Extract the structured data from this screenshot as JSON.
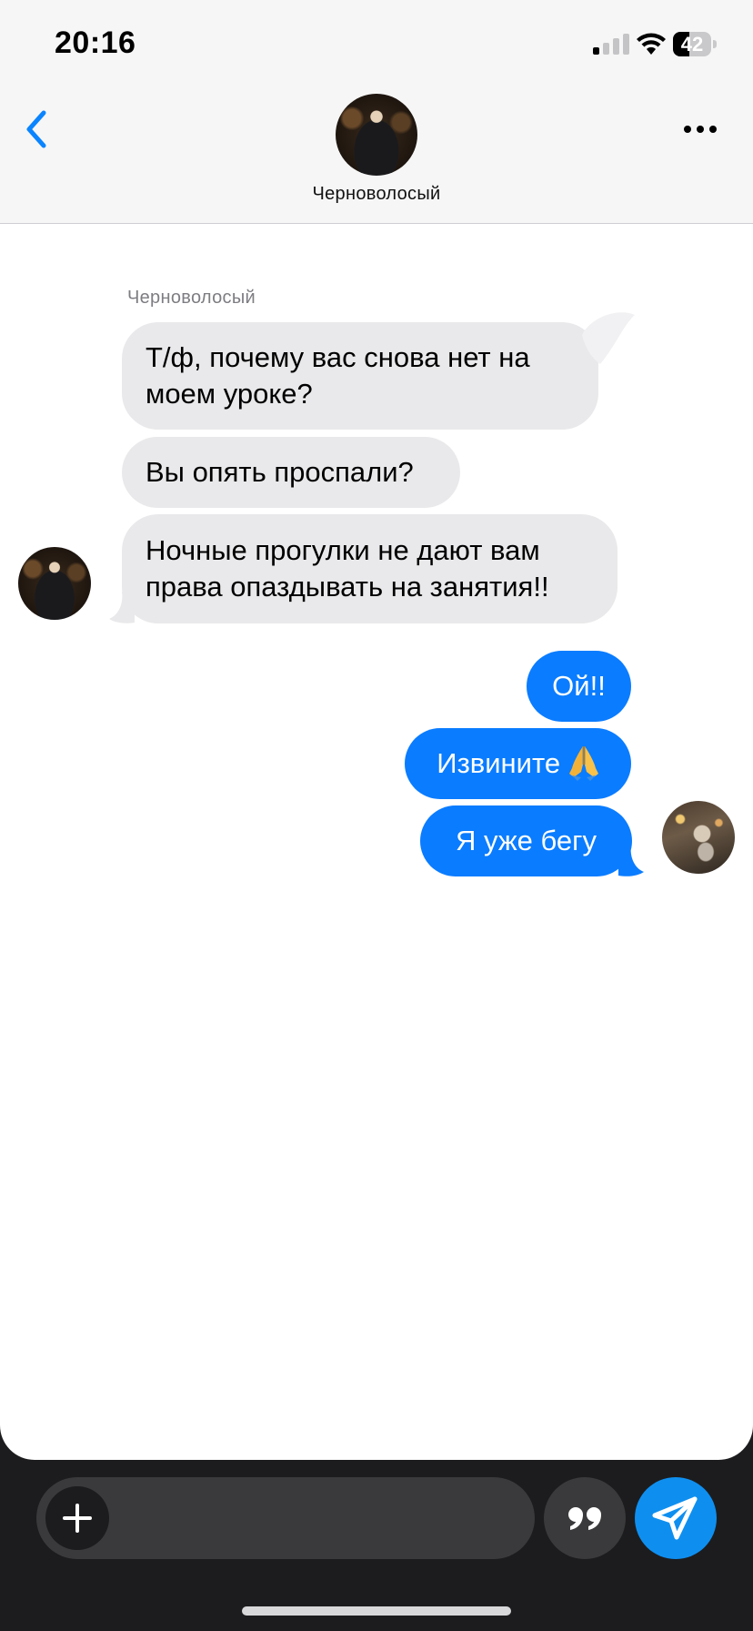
{
  "status_bar": {
    "time": "20:16",
    "battery_level": "42",
    "signal_bars_active": 1,
    "signal_bars_total": 4
  },
  "header": {
    "contact_name": "Черноволосый",
    "back_icon": "chevron-left-icon",
    "more_icon": "ellipsis-icon"
  },
  "chat": {
    "sender_label": "Черноволосый",
    "incoming": [
      {
        "text_line1": "Т/ф, почему вас снова нет на",
        "text_line2": "моем уроке?"
      },
      {
        "text": "Вы опять проспали?"
      },
      {
        "text_line1": "Ночные прогулки не дают вам",
        "text_line2": "права опаздывать на занятия!!"
      }
    ],
    "outgoing": [
      {
        "text": "Ой!!"
      },
      {
        "text": "Извините",
        "emoji": "folded-hands-icon"
      },
      {
        "text": "Я уже бегу"
      }
    ]
  },
  "composer": {
    "add_icon": "plus-icon",
    "quote_icon": "quote-icon",
    "send_icon": "paper-plane-icon"
  },
  "colors": {
    "incoming_bubble": "#e9e9eb",
    "outgoing_bubble": "#0a7cff",
    "accent": "#0a84ff",
    "send_button": "#0e8ff0",
    "background_dark": "#1c1c1e"
  }
}
